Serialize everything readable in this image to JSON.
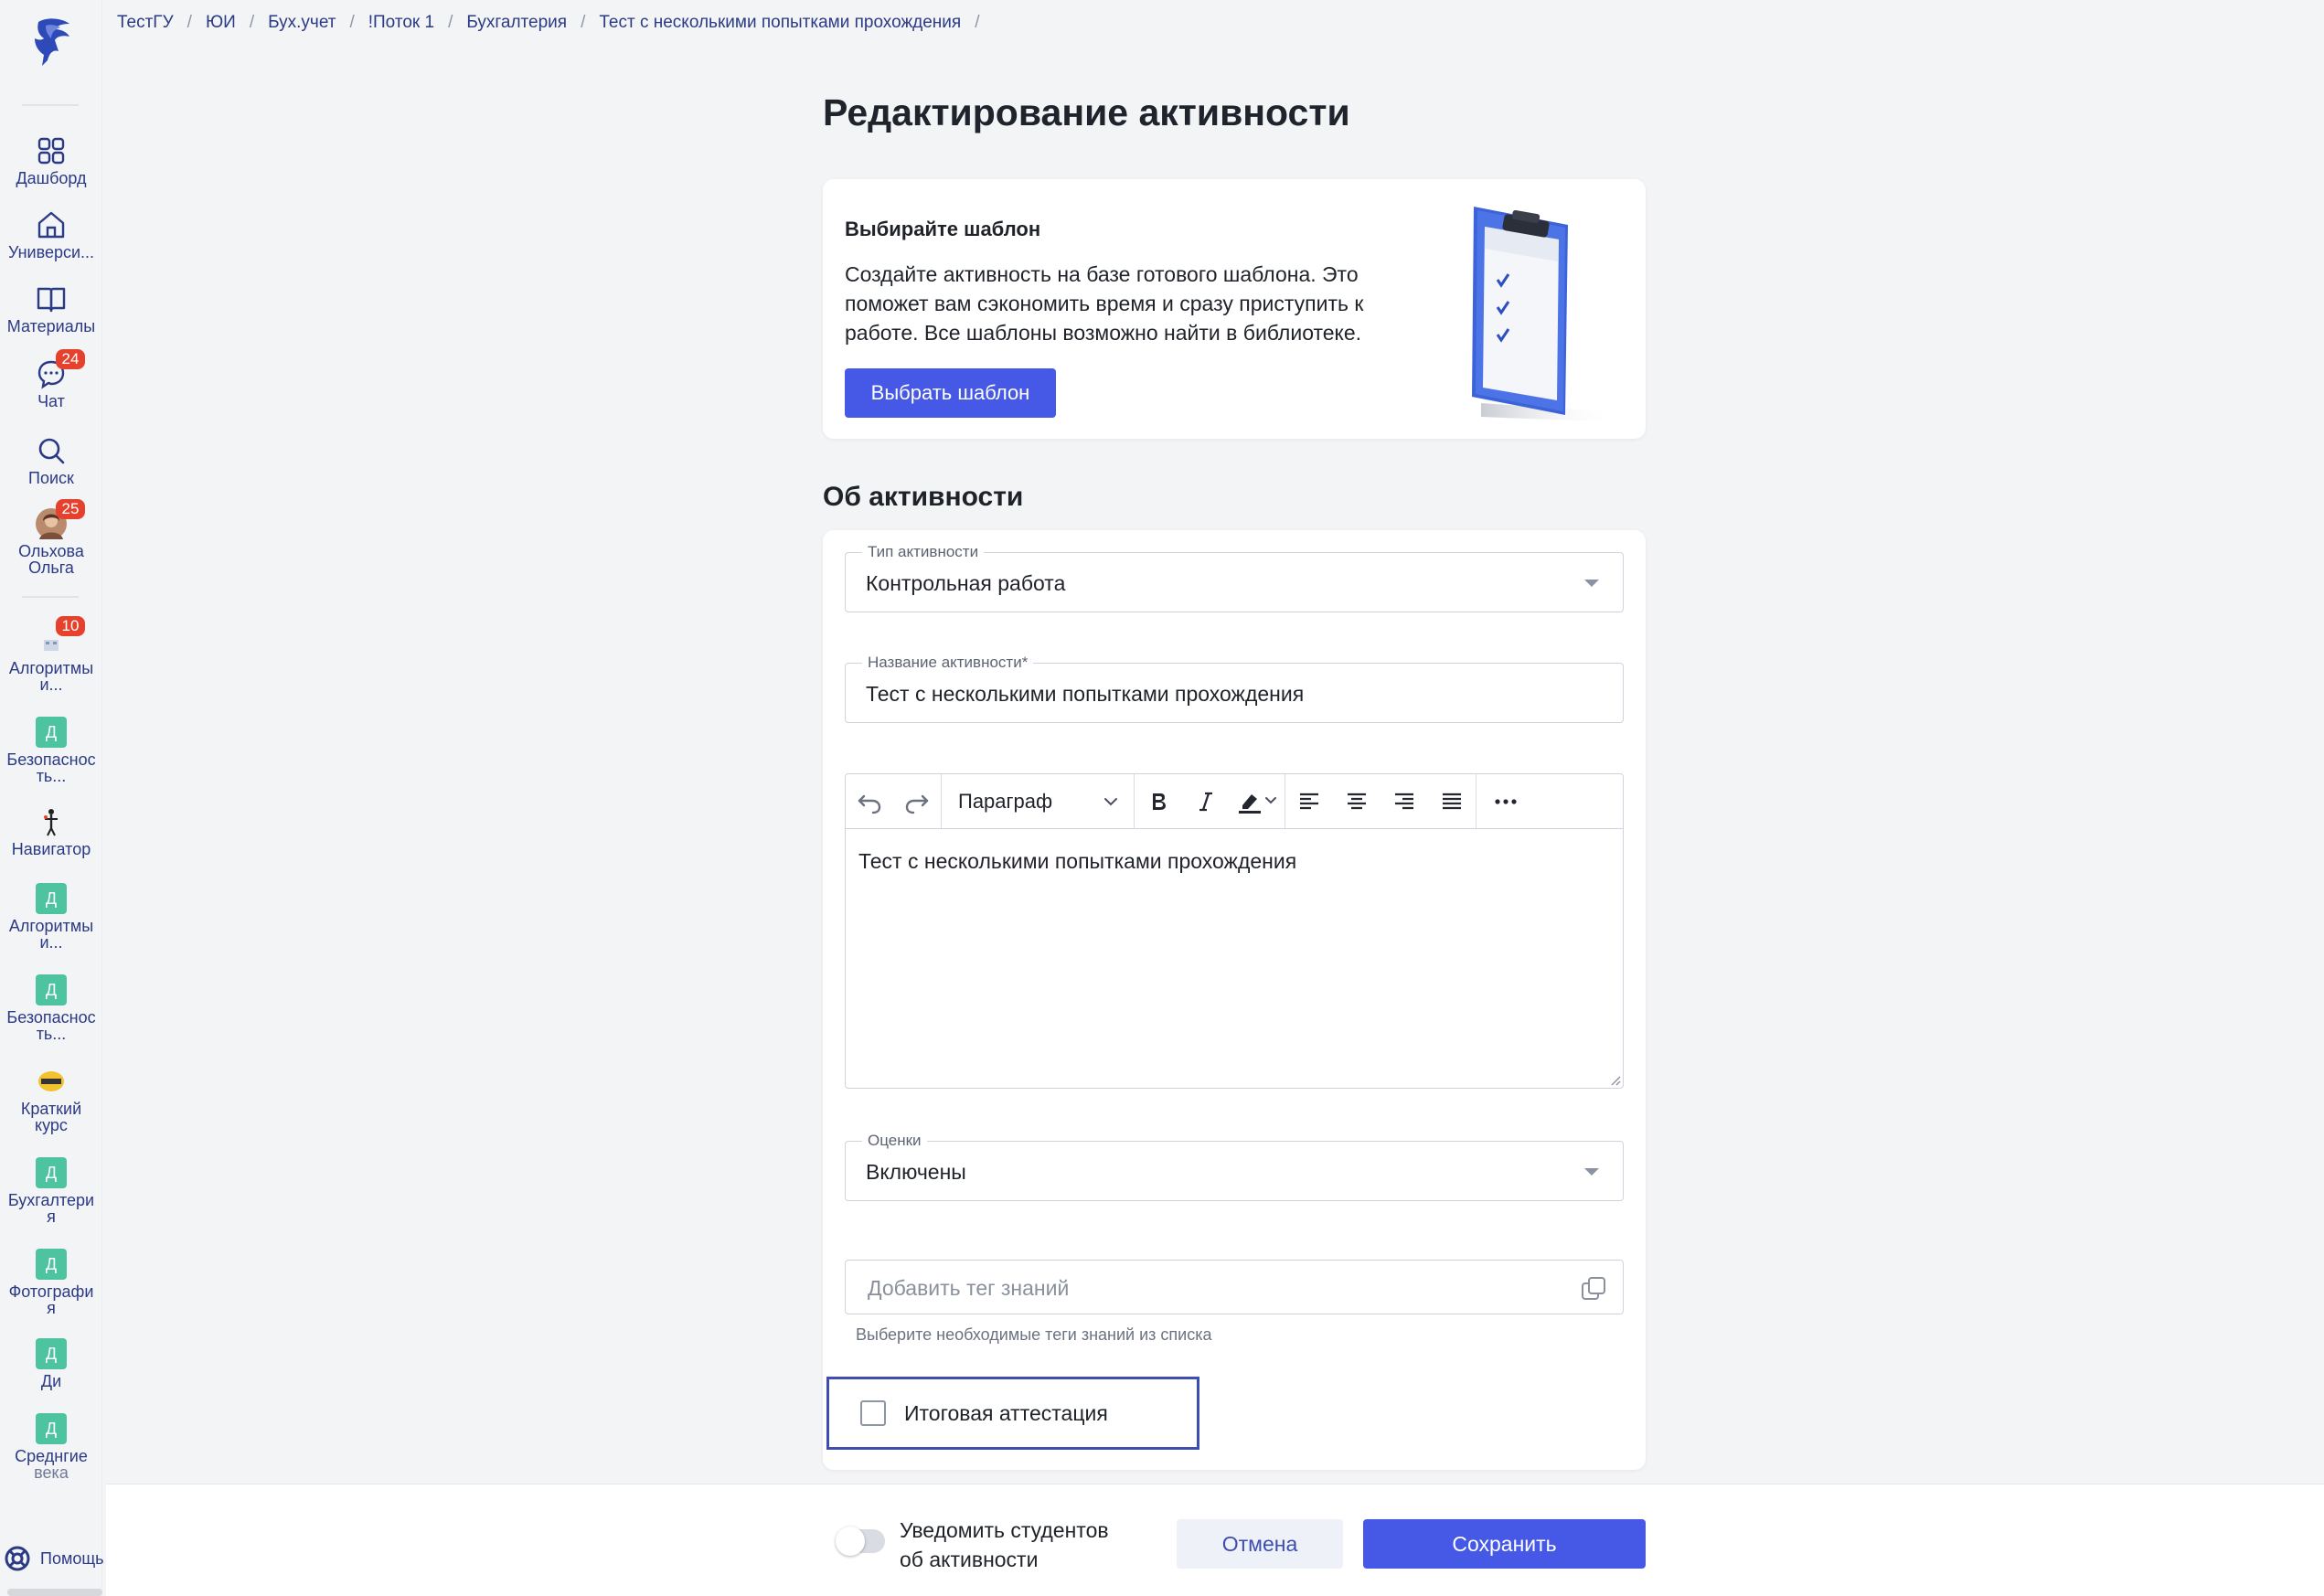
{
  "breadcrumb": [
    "ТестГУ",
    "ЮИ",
    "Бух.учет",
    "!Поток 1",
    "Бухгалтерия",
    "Тест с несколькими попытками прохождения"
  ],
  "sidebar": {
    "nav": [
      {
        "label": "Дашборд",
        "icon": "grid-icon"
      },
      {
        "label": "Универси...",
        "icon": "home-icon"
      },
      {
        "label": "Материалы",
        "icon": "book-icon"
      },
      {
        "label": "Чат",
        "icon": "chat-icon",
        "badge": "24"
      },
      {
        "label": "Поиск",
        "icon": "search-icon"
      },
      {
        "label": "Ольхова\nОльга",
        "icon": "avatar",
        "badge": "25"
      }
    ],
    "courses": [
      {
        "label": "Алгоритмы\nи...",
        "badge": "10",
        "icon": "course-image"
      },
      {
        "label": "Безопаснос\nть...",
        "letter": "Д"
      },
      {
        "label": "Навигатор",
        "icon": "course-image"
      },
      {
        "label": "Алгоритмы\nи...",
        "letter": "Д"
      },
      {
        "label": "Безопаснос\nть...",
        "letter": "Д"
      },
      {
        "label": "Краткий\nкурс",
        "icon": "course-image"
      },
      {
        "label": "Бухгалтери\nя",
        "letter": "Д"
      },
      {
        "label": "Фотографи\nя",
        "letter": "Д"
      },
      {
        "label": "Ди",
        "letter": "Д"
      },
      {
        "label": "Среднгие",
        "sub": "века",
        "letter": "Д"
      }
    ],
    "help_label": "Помощь"
  },
  "page": {
    "title": "Редактирование активности"
  },
  "template_card": {
    "title": "Выбирайте шаблон",
    "text": "Создайте активность на базе готового шаблона. Это поможет вам сэкономить время и сразу приступить к работе. Все шаблоны возможно найти в библиотеке.",
    "button": "Выбрать шаблон"
  },
  "about": {
    "section_title": "Об активности",
    "type_legend": "Тип активности",
    "type_value": "Контрольная работа",
    "name_legend": "Название активности*",
    "name_value": "Тест с несколькими попытками прохождения",
    "editor": {
      "paragraph": "Параграф",
      "content": "Тест с несколькими попытками прохождения"
    },
    "grades_legend": "Оценки",
    "grades_value": "Включены",
    "tag_placeholder": "Добавить тег знаний",
    "tag_hint": "Выберите необходимые теги знаний из списка",
    "final_attestation": "Итоговая аттестация",
    "final_attestation_checked": false
  },
  "footer": {
    "notify_label": "Уведомить студентов об активности",
    "notify_on": false,
    "cancel": "Отмена",
    "save": "Сохранить"
  },
  "colors": {
    "accent": "#4558e6",
    "nav_text": "#2b3a85",
    "badge": "#e5412d",
    "course_square": "#4dc39f",
    "highlight_border": "#3d4db0"
  }
}
